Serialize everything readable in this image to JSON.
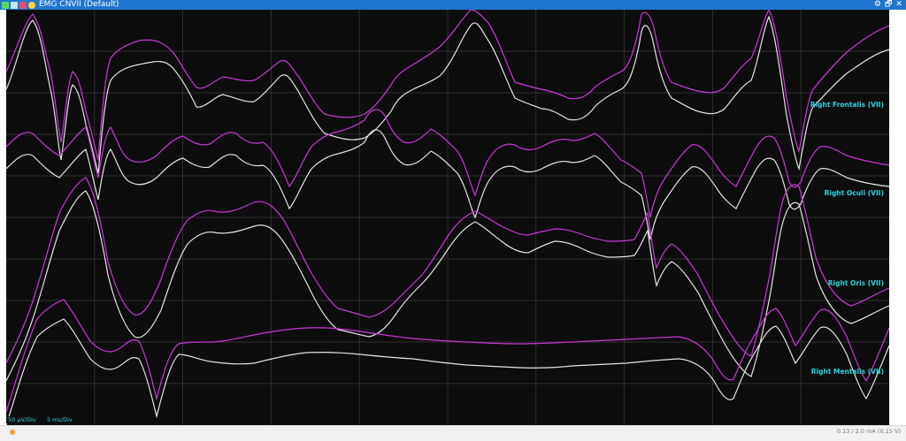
{
  "window": {
    "title": "EMG CNVII (Default)",
    "controls": {
      "settings": "⚙",
      "restore": "🗗",
      "close": "✕"
    },
    "accent_color": "#1f76cf"
  },
  "channels": [
    {
      "label": "Right Frontalis (VII)"
    },
    {
      "label": "Right Oculi (VII)"
    },
    {
      "label": "Right Oris (VII)"
    },
    {
      "label": "Right Mentalis (VII)"
    }
  ],
  "scale": {
    "amplitude": "50 µV/Div",
    "time": "5 ms/Div"
  },
  "status": {
    "stimulus": "0.13 / 2.0 mA (0.15 V)"
  },
  "trace_colors": {
    "current": "#c63bd4",
    "baseline": "#e4e4e4",
    "label": "#27d5dc"
  }
}
